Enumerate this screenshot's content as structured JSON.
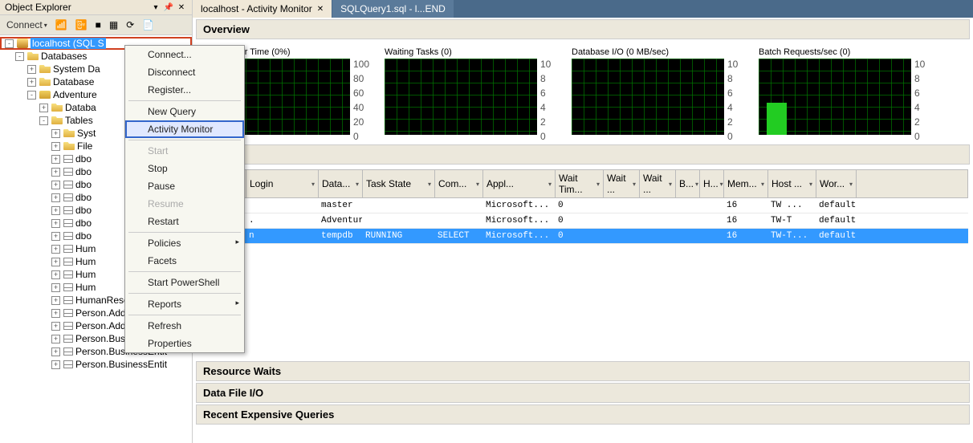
{
  "objectExplorer": {
    "title": "Object Explorer",
    "connectBtn": "Connect",
    "tree": {
      "server": "localhost (SQL S",
      "nodes": [
        {
          "lvl": 1,
          "exp": "-",
          "ico": "fold",
          "label": "Databases"
        },
        {
          "lvl": 2,
          "exp": "+",
          "ico": "fold",
          "label": "System Da"
        },
        {
          "lvl": 2,
          "exp": "+",
          "ico": "fold",
          "label": "Database"
        },
        {
          "lvl": 2,
          "exp": "-",
          "ico": "db",
          "label": "Adventure"
        },
        {
          "lvl": 3,
          "exp": "+",
          "ico": "fold",
          "label": "Databa"
        },
        {
          "lvl": 3,
          "exp": "-",
          "ico": "fold",
          "label": "Tables"
        },
        {
          "lvl": 4,
          "exp": "+",
          "ico": "fold",
          "label": "Syst"
        },
        {
          "lvl": 4,
          "exp": "+",
          "ico": "fold",
          "label": "File"
        },
        {
          "lvl": 4,
          "exp": "+",
          "ico": "table",
          "label": "dbo"
        },
        {
          "lvl": 4,
          "exp": "+",
          "ico": "table",
          "label": "dbo"
        },
        {
          "lvl": 4,
          "exp": "+",
          "ico": "table",
          "label": "dbo"
        },
        {
          "lvl": 4,
          "exp": "+",
          "ico": "table",
          "label": "dbo"
        },
        {
          "lvl": 4,
          "exp": "+",
          "ico": "table",
          "label": "dbo"
        },
        {
          "lvl": 4,
          "exp": "+",
          "ico": "table",
          "label": "dbo"
        },
        {
          "lvl": 4,
          "exp": "+",
          "ico": "table",
          "label": "dbo"
        },
        {
          "lvl": 4,
          "exp": "+",
          "ico": "table",
          "label": "Hum"
        },
        {
          "lvl": 4,
          "exp": "+",
          "ico": "table",
          "label": "Hum"
        },
        {
          "lvl": 4,
          "exp": "+",
          "ico": "table",
          "label": "Hum"
        },
        {
          "lvl": 4,
          "exp": "+",
          "ico": "table",
          "label": "Hum"
        },
        {
          "lvl": 4,
          "exp": "+",
          "ico": "table",
          "label": "HumanResources.S"
        },
        {
          "lvl": 4,
          "exp": "+",
          "ico": "table",
          "label": "Person.Address"
        },
        {
          "lvl": 4,
          "exp": "+",
          "ico": "table",
          "label": "Person.AddressType"
        },
        {
          "lvl": 4,
          "exp": "+",
          "ico": "table",
          "label": "Person.BusinessEntit"
        },
        {
          "lvl": 4,
          "exp": "+",
          "ico": "table",
          "label": "Person.BusinessEntit"
        },
        {
          "lvl": 4,
          "exp": "+",
          "ico": "table",
          "label": "Person.BusinessEntit"
        }
      ]
    }
  },
  "contextMenu": {
    "items": [
      {
        "label": "Connect...",
        "type": "item"
      },
      {
        "label": "Disconnect",
        "type": "item"
      },
      {
        "label": "Register...",
        "type": "item"
      },
      {
        "type": "sep"
      },
      {
        "label": "New Query",
        "type": "item"
      },
      {
        "label": "Activity Monitor",
        "type": "item",
        "highlighted": true
      },
      {
        "type": "sep"
      },
      {
        "label": "Start",
        "type": "item",
        "disabled": true
      },
      {
        "label": "Stop",
        "type": "item"
      },
      {
        "label": "Pause",
        "type": "item"
      },
      {
        "label": "Resume",
        "type": "item",
        "disabled": true
      },
      {
        "label": "Restart",
        "type": "item"
      },
      {
        "type": "sep"
      },
      {
        "label": "Policies",
        "type": "item",
        "sub": true
      },
      {
        "label": "Facets",
        "type": "item"
      },
      {
        "type": "sep"
      },
      {
        "label": "Start PowerShell",
        "type": "item"
      },
      {
        "type": "sep"
      },
      {
        "label": "Reports",
        "type": "item",
        "sub": true
      },
      {
        "type": "sep"
      },
      {
        "label": "Refresh",
        "type": "item"
      },
      {
        "label": "Properties",
        "type": "item"
      }
    ]
  },
  "tabs": [
    {
      "label": "localhost - Activity Monitor",
      "active": true,
      "closable": true
    },
    {
      "label": "SQLQuery1.sql - l...END",
      "active": false,
      "closable": false
    }
  ],
  "overview": {
    "title": "Overview",
    "charts": [
      {
        "title": "% Processor Time (0%)",
        "yticks": [
          "100",
          "80",
          "60",
          "40",
          "20",
          "0"
        ]
      },
      {
        "title": "Waiting Tasks (0)",
        "yticks": [
          "10",
          "8",
          "6",
          "4",
          "2",
          "0"
        ]
      },
      {
        "title": "Database I/O (0 MB/sec)",
        "yticks": [
          "10",
          "8",
          "6",
          "4",
          "2",
          "0"
        ]
      },
      {
        "title": "Batch Requests/sec (0)",
        "yticks": [
          "10",
          "8",
          "6",
          "4",
          "2",
          "0"
        ],
        "hasBar": true
      }
    ]
  },
  "processes": {
    "title": "ses",
    "columns": [
      "",
      "",
      "Login",
      "Data...",
      "Task State",
      "Com...",
      "Appl...",
      "Wait Tim...",
      "Wait ...",
      "Wait ...",
      "B...",
      "H...",
      "Mem...",
      "Host ...",
      "Wor..."
    ],
    "rows": [
      {
        "sess": "",
        "uproc": "i",
        "login": "",
        "data": "master",
        "task": "",
        "com": "",
        "appl": "Microsoft...",
        "wtim": "0",
        "wtyp": "",
        "wres": "",
        "blk": "",
        "hd": "",
        "mem": "16",
        "host": "TW    ...",
        "wor": "default"
      },
      {
        "sess": "",
        "uproc": "i",
        "login": ".",
        "data": "Adventur...",
        "task": "",
        "com": "",
        "appl": "Microsoft...",
        "wtim": "0",
        "wtyp": "",
        "wres": "",
        "blk": "",
        "hd": "",
        "mem": "16",
        "host": "TW-T",
        "wor": "default"
      },
      {
        "sess": "",
        "uproc": "",
        "login": "n",
        "data": "tempdb",
        "task": "RUNNING",
        "com": "SELECT",
        "appl": "Microsoft...",
        "wtim": "0",
        "wtyp": "",
        "wres": "",
        "blk": "",
        "hd": "",
        "mem": "16",
        "host": "TW-T...",
        "wor": "default",
        "selected": true
      }
    ]
  },
  "sections": {
    "resourceWaits": "Resource Waits",
    "dataFileIO": "Data File I/O",
    "recentQueries": "Recent Expensive Queries"
  },
  "chart_data": [
    {
      "type": "line",
      "title": "% Processor Time (0%)",
      "values": [
        0
      ],
      "ylim": [
        0,
        100
      ],
      "ylabel": "",
      "xlabel": ""
    },
    {
      "type": "line",
      "title": "Waiting Tasks (0)",
      "values": [
        0
      ],
      "ylim": [
        0,
        10
      ],
      "ylabel": "",
      "xlabel": ""
    },
    {
      "type": "line",
      "title": "Database I/O (0 MB/sec)",
      "values": [
        0
      ],
      "ylim": [
        0,
        10
      ],
      "ylabel": "",
      "xlabel": ""
    },
    {
      "type": "area",
      "title": "Batch Requests/sec (0)",
      "values": [
        4,
        4,
        0,
        0,
        0,
        0,
        0,
        0,
        0,
        0,
        0,
        0
      ],
      "ylim": [
        0,
        10
      ],
      "ylabel": "",
      "xlabel": ""
    }
  ]
}
